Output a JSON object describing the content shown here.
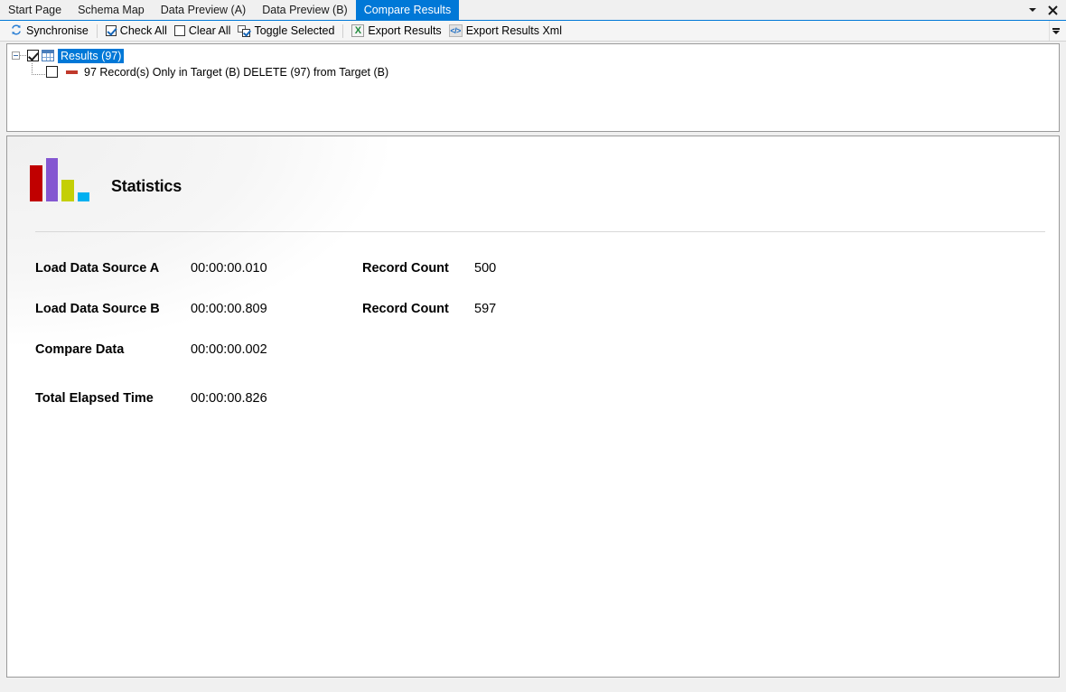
{
  "tabs": [
    {
      "label": "Start Page",
      "active": false
    },
    {
      "label": "Schema Map",
      "active": false
    },
    {
      "label": "Data Preview (A)",
      "active": false
    },
    {
      "label": "Data Preview (B)",
      "active": false
    },
    {
      "label": "Compare Results",
      "active": true
    }
  ],
  "window_controls": {
    "dropdown_icon": "chevron-down-icon",
    "close_label": "✕"
  },
  "toolbar": {
    "synchronise_label": "Synchronise",
    "check_all_label": "Check All",
    "clear_all_label": "Clear All",
    "toggle_selected_label": "Toggle Selected",
    "export_results_label": "Export Results",
    "export_results_xml_label": "Export Results Xml",
    "excel_glyph": "X",
    "xml_glyph": "</>",
    "overflow_icon": "toolbar-overflow-icon"
  },
  "tree": {
    "root": {
      "label": "Results (97)",
      "checked": true,
      "selected": true,
      "expanded": true
    },
    "children": [
      {
        "label": "97 Record(s) Only in Target (B) DELETE (97) from Target (B)",
        "checked": false,
        "marker": "delete-marker"
      }
    ]
  },
  "statistics": {
    "title": "Statistics",
    "icon": "bar-chart-icon",
    "rows": [
      {
        "label": "Load Data Source A",
        "value": "00:00:00.010",
        "label2": "Record Count",
        "value2": "500"
      },
      {
        "label": "Load Data Source B",
        "value": "00:00:00.809",
        "label2": "Record Count",
        "value2": "597"
      },
      {
        "label": "Compare Data",
        "value": "00:00:00.002",
        "label2": "",
        "value2": ""
      },
      {
        "label": "Total Elapsed Time",
        "value": "00:00:00.826",
        "label2": "",
        "value2": ""
      }
    ]
  },
  "chart_data": {
    "type": "bar",
    "title": "Statistics",
    "categories": [
      "1",
      "2",
      "3",
      "4"
    ],
    "values": [
      40,
      48,
      24,
      10
    ],
    "colors": [
      "#c00000",
      "#8457d1",
      "#c4cf06",
      "#00b0f0"
    ],
    "ylim": [
      0,
      50
    ],
    "xlabel": "",
    "ylabel": "",
    "grid": false,
    "legend": "none"
  },
  "colors": {
    "accent": "#0078d7",
    "panel_border": "#9a9a9a",
    "toolbar_bg": "#f5f5f5",
    "window_bg": "#f0f0f0",
    "delete_marker": "#c0392b"
  }
}
